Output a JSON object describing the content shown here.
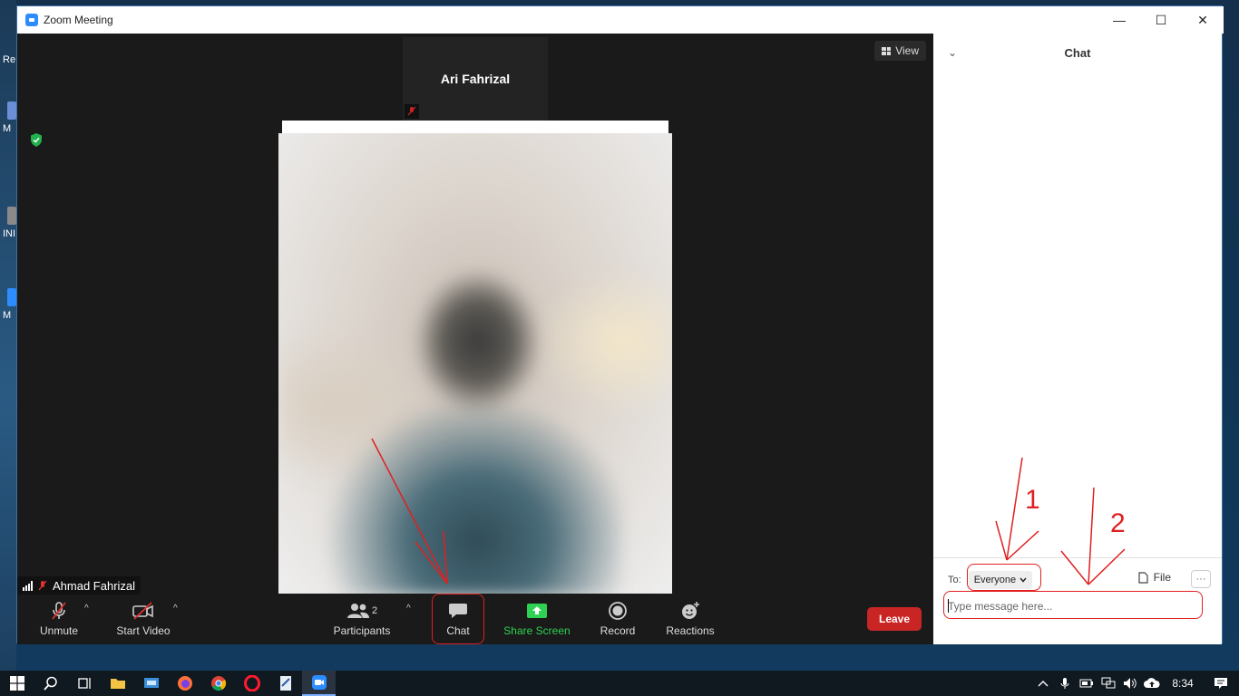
{
  "window": {
    "title": "Zoom Meeting",
    "minimize": "—",
    "maximize": "☐",
    "close": "✕"
  },
  "desktop": {
    "icons": [
      "Re",
      "M",
      "INI -",
      "M"
    ]
  },
  "meeting": {
    "speaker_name": "Ari Fahrizal",
    "view_label": "View",
    "self_name": "Ahmad Fahrizal"
  },
  "toolbar": {
    "unmute": "Unmute",
    "start_video": "Start Video",
    "participants": "Participants",
    "participants_count": "2",
    "chat": "Chat",
    "share_screen": "Share Screen",
    "record": "Record",
    "reactions": "Reactions",
    "leave": "Leave",
    "caret": "^"
  },
  "chat_panel": {
    "title": "Chat",
    "collapse": "⌄",
    "to_label": "To:",
    "recipient": "Everyone",
    "file_label": "File",
    "more_label": "···",
    "input_placeholder": "Type message here..."
  },
  "annotations": {
    "num1": "1",
    "num2": "2"
  },
  "taskbar": {
    "clock": "8:34"
  },
  "colors": {
    "leave": "#c92525",
    "share": "#2fd152",
    "annotation": "#e02020",
    "zoom_blue": "#2d8cff"
  }
}
